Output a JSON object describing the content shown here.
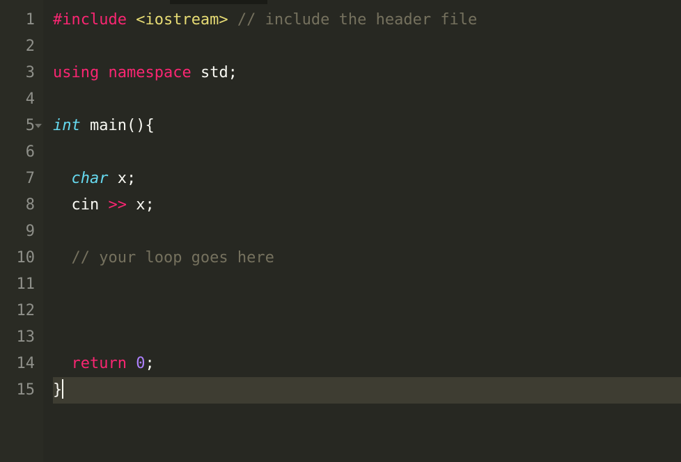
{
  "editor": {
    "lineNumbers": [
      "1",
      "2",
      "3",
      "4",
      "5",
      "6",
      "7",
      "8",
      "9",
      "10",
      "11",
      "12",
      "13",
      "14",
      "15"
    ],
    "foldAtLine": 5,
    "activeLine": 15,
    "cursor": {
      "line": 15,
      "afterCol": 1
    },
    "lines": [
      [
        {
          "cls": "tok-keyword",
          "t": "#include"
        },
        {
          "cls": "tok-plain",
          "t": " "
        },
        {
          "cls": "tok-string",
          "t": "<iostream>"
        },
        {
          "cls": "tok-plain",
          "t": " "
        },
        {
          "cls": "tok-comment",
          "t": "// include the header file"
        }
      ],
      [],
      [
        {
          "cls": "tok-keyword",
          "t": "using"
        },
        {
          "cls": "tok-plain",
          "t": " "
        },
        {
          "cls": "tok-keyword",
          "t": "namespace"
        },
        {
          "cls": "tok-plain",
          "t": " std;"
        }
      ],
      [],
      [
        {
          "cls": "tok-type",
          "t": "int"
        },
        {
          "cls": "tok-plain",
          "t": " "
        },
        {
          "cls": "tok-func",
          "t": "main"
        },
        {
          "cls": "tok-plain",
          "t": "(){"
        }
      ],
      [],
      [
        {
          "cls": "tok-plain",
          "t": "  "
        },
        {
          "cls": "tok-type",
          "t": "char"
        },
        {
          "cls": "tok-plain",
          "t": " x;"
        }
      ],
      [
        {
          "cls": "tok-plain",
          "t": "  cin "
        },
        {
          "cls": "tok-op",
          "t": ">>"
        },
        {
          "cls": "tok-plain",
          "t": " x;"
        }
      ],
      [],
      [
        {
          "cls": "tok-plain",
          "t": "  "
        },
        {
          "cls": "tok-comment",
          "t": "// your loop goes here"
        }
      ],
      [],
      [],
      [],
      [
        {
          "cls": "tok-plain",
          "t": "  "
        },
        {
          "cls": "tok-keyword",
          "t": "return"
        },
        {
          "cls": "tok-plain",
          "t": " "
        },
        {
          "cls": "tok-number",
          "t": "0"
        },
        {
          "cls": "tok-plain",
          "t": ";"
        }
      ],
      [
        {
          "cls": "tok-plain",
          "t": "}"
        }
      ]
    ]
  }
}
